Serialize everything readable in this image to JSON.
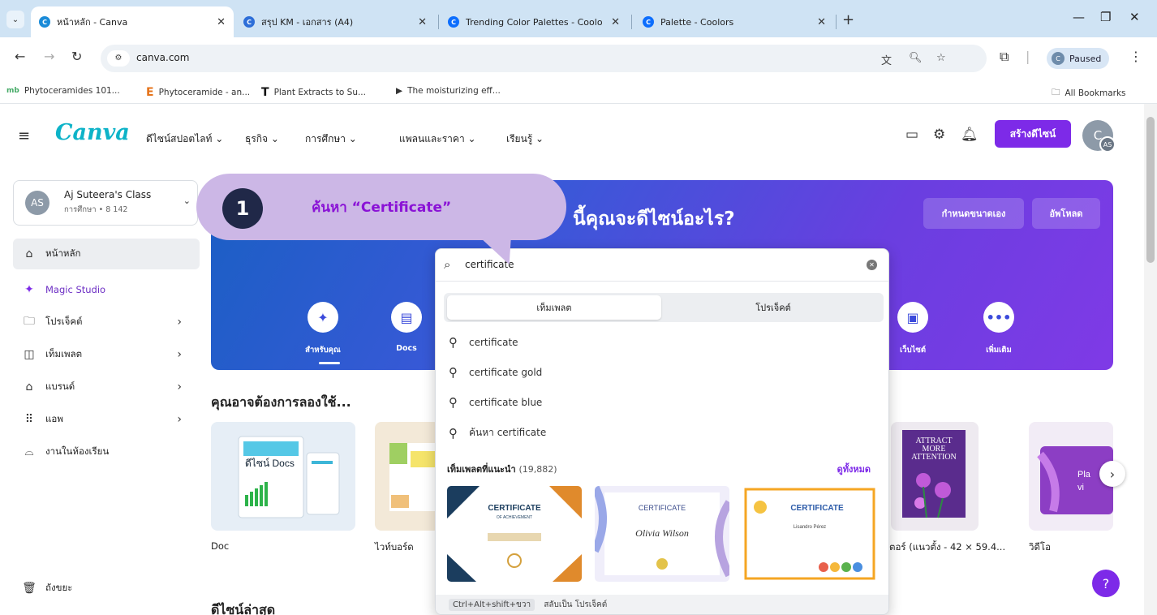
{
  "browser": {
    "tabs": [
      {
        "title": "หน้าหลัก - Canva"
      },
      {
        "title": "สรุป KM - เอกสาร (A4)"
      },
      {
        "title": "Trending Color Palettes - Coolo"
      },
      {
        "title": "Palette - Coolors"
      }
    ],
    "url": "canva.com",
    "profile_status": "Paused",
    "profile_initial": "C",
    "bookmarks": [
      "Phytoceramides 101...",
      "Phytoceramide - an...",
      "Plant Extracts to Su...",
      "The moisturizing eff..."
    ],
    "all_bookmarks": "All Bookmarks"
  },
  "canva": {
    "logo": "Canva",
    "nav": [
      "ดีไซน์สปอตไลท์",
      "ธุรกิจ",
      "การศึกษา",
      "แพลนและราคา",
      "เรียนรู้"
    ],
    "create_button": "สร้างดีไซน์",
    "avatar_initial": "C",
    "avatar_badge": "AS",
    "team": {
      "initials": "AS",
      "name": "Aj Suteera's Class",
      "sub": "การศึกษา • 8 142"
    },
    "sidebar": [
      {
        "label": "หน้าหลัก",
        "icon": "home-icon"
      },
      {
        "label": "Magic Studio",
        "icon": "magic-sparkle-icon"
      },
      {
        "label": "โปรเจ็คต์",
        "icon": "folder-icon"
      },
      {
        "label": "เท็มเพลต",
        "icon": "template-icon"
      },
      {
        "label": "แบรนด์",
        "icon": "brand-icon"
      },
      {
        "label": "แอพ",
        "icon": "apps-grid-icon"
      },
      {
        "label": "งานในห้องเรียน",
        "icon": "classroom-icon"
      }
    ],
    "trash_label": "ถังขยะ",
    "banner": {
      "title": "นี้คุณจะดีไซน์อะไร?",
      "custom_size": "กำหนดขนาดเอง",
      "upload": "อัพโหลด",
      "categories": [
        "สำหรับคุณ",
        "Docs",
        "เว็บไซต์",
        "เพิ่มเติม"
      ]
    },
    "try_section_title": "คุณอาจต้องการลองใช้...",
    "cards": [
      "Doc",
      "ไวท์บอร์ด",
      "ตอร์ (แนวตั้ง - 42 × 59.4...",
      "วิดีโอ"
    ],
    "recent_title": "ดีไซน์ล่าสุด",
    "help": "?"
  },
  "search": {
    "query": "certificate",
    "tabs": [
      "เท็มเพลต",
      "โปรเจ็คต์"
    ],
    "suggestions": [
      "certificate",
      "certificate gold",
      "certificate blue",
      "ค้นหา certificate"
    ],
    "recommended_title": "เท็มเพลตที่แนะนำ",
    "recommended_count": "(19,882)",
    "see_all": "ดูทั้งหมด",
    "templates": [
      {
        "title": "CERTIFICATE",
        "subtitle": "OF ACHIEVEMENT"
      },
      {
        "title": "CERTIFICATE",
        "name": "Olivia Wilson"
      },
      {
        "title": "CERTIFICATE",
        "name": "Lisandro Pérez"
      }
    ],
    "shortcut_key": "Ctrl+Alt+shift+ขวา",
    "shortcut_label": "สลับเป็น โปรเจ็คต์"
  },
  "callout": {
    "number": "1",
    "text": "ค้นหา “Certificate”"
  }
}
